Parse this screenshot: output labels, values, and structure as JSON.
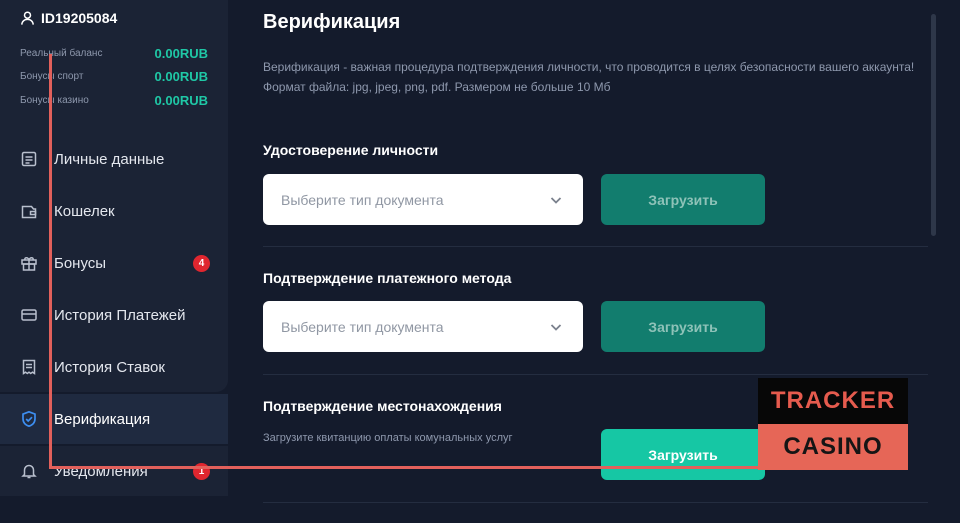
{
  "user": {
    "id": "ID19205084",
    "icon": "user-icon"
  },
  "balances": [
    {
      "label": "Реальный баланс",
      "value": "0.00RUB"
    },
    {
      "label": "Бонусы спорт",
      "value": "0.00RUB"
    },
    {
      "label": "Бонусы казино",
      "value": "0.00RUB"
    }
  ],
  "menu": [
    {
      "label": "Личные данные",
      "icon": "document-icon"
    },
    {
      "label": "Кошелек",
      "icon": "wallet-icon"
    },
    {
      "label": "Бонусы",
      "icon": "gift-icon",
      "badge": "4"
    },
    {
      "label": "История Платежей",
      "icon": "card-icon"
    },
    {
      "label": "История Ставок",
      "icon": "receipt-icon"
    },
    {
      "label": "Верификация",
      "icon": "shield-check-icon",
      "active": true
    },
    {
      "label": "Уведомления",
      "icon": "bell-icon",
      "badge": "1"
    }
  ],
  "main": {
    "title": "Верификация",
    "description": "Верификация - важная процедура подтверждения личности, что проводится в целях безопасности вашего аккаунта! Формат файла: jpg, jpeg, png, pdf. Размером не больше 10 Мб",
    "sections": [
      {
        "title": "Удостоверение личности",
        "select_placeholder": "Выберите тип документа",
        "button": "Загрузить"
      },
      {
        "title": "Подтверждение платежного метода",
        "select_placeholder": "Выберите тип документа",
        "button": "Загрузить"
      },
      {
        "title": "Подтверждение местонахождения",
        "hint": "Загрузите квитанцию оплаты комунальных услуг",
        "button": "Загрузить"
      }
    ]
  },
  "watermark": {
    "line1": "TRACKER",
    "line2": "CASINO"
  },
  "colors": {
    "accent": "#16c7a4",
    "accent_dim": "#127d6e",
    "badge": "#e0262f",
    "overlay_line": "#e2605b"
  }
}
